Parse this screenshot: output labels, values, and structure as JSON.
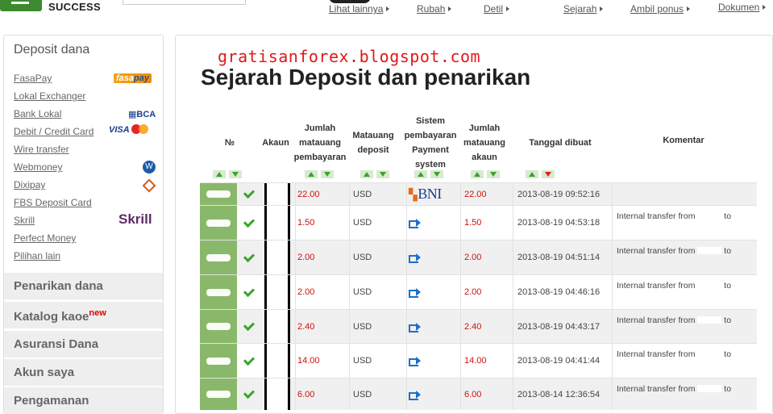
{
  "header": {
    "logo_text": "SUCCESS",
    "nav": [
      "Lihat lainnya",
      "Rubah",
      "Detil",
      "Sejarah",
      "Ambil ponus",
      "Dokumen"
    ]
  },
  "sidebar": {
    "title": "Deposit dana",
    "links": [
      "FasaPay",
      "Lokal Exchanger",
      "Bank Lokal",
      "Debit / Credit Card",
      "Wire transfer",
      "Webmoney",
      "Dixipay",
      "FBS Deposit Card",
      "Skrill",
      "Perfect Money",
      "Pilihan lain"
    ],
    "logos": {
      "fasapay_a": "fasa",
      "fasapay_b": "pay",
      "bca": "BCA",
      "visa": "VISA",
      "skrill": "Skrill",
      "webmoney": "W"
    },
    "sections": [
      "Penarikan dana",
      "Katalog kaoe",
      "Asuransi Dana",
      "Akun saya",
      "Pengamanan"
    ],
    "new_badge": "new"
  },
  "main": {
    "watermark": "gratisanforex.blogspot.com",
    "title": "Sejarah Deposit dan penarikan",
    "columns": [
      "№",
      "Akaun",
      "Jumlah matauang pembayaran",
      "Matauang deposit",
      "Sistem pembayaran Payment system",
      "Jumlah matauang akaun",
      "Tanggal dibuat",
      "Komentar"
    ]
  },
  "table": {
    "rows": [
      {
        "amount": "22.00",
        "currency": "USD",
        "system": "BNI",
        "amount_acct": "22.00",
        "date": "2013-08-19 09:52:16",
        "comment_a": "",
        "comment_b": ""
      },
      {
        "amount": "1.50",
        "currency": "USD",
        "system": "internal",
        "amount_acct": "1.50",
        "date": "2013-08-19 04:53:18",
        "comment_a": "Internal transfer from",
        "comment_b": "to"
      },
      {
        "amount": "2.00",
        "currency": "USD",
        "system": "internal",
        "amount_acct": "2.00",
        "date": "2013-08-19 04:51:14",
        "comment_a": "Internal transfer from",
        "comment_b": "to"
      },
      {
        "amount": "2.00",
        "currency": "USD",
        "system": "internal",
        "amount_acct": "2.00",
        "date": "2013-08-19 04:46:16",
        "comment_a": "Internal transfer from",
        "comment_b": "to"
      },
      {
        "amount": "2.40",
        "currency": "USD",
        "system": "internal",
        "amount_acct": "2.40",
        "date": "2013-08-19 04:43:17",
        "comment_a": "Internal transfer from",
        "comment_b": "to"
      },
      {
        "amount": "14.00",
        "currency": "USD",
        "system": "internal",
        "amount_acct": "14.00",
        "date": "2013-08-19 04:41:44",
        "comment_a": "Internal transfer from",
        "comment_b": "to"
      },
      {
        "amount": "6.00",
        "currency": "USD",
        "system": "internal",
        "amount_acct": "6.00",
        "date": "2013-08-14 12:36:54",
        "comment_a": "Internal transfer from",
        "comment_b": "to"
      }
    ]
  },
  "colors": {
    "brand_green": "#3d8a2e",
    "amount_red": "#d01010",
    "row_green": "#8ab86a"
  }
}
